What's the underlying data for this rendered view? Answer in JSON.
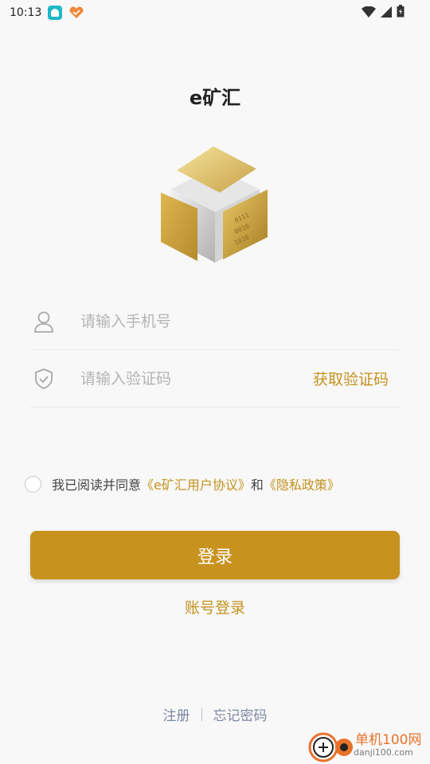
{
  "status_bar": {
    "time": "10:13"
  },
  "app": {
    "title": "e矿汇"
  },
  "form": {
    "phone_placeholder": "请输入手机号",
    "code_placeholder": "请输入验证码",
    "get_code_label": "获取验证码"
  },
  "agreement": {
    "prefix": "我已阅读并同意",
    "user_agreement": "《e矿汇用户协议》",
    "conjunction": "和",
    "privacy_policy": "《隐私政策》"
  },
  "login_button": "登录",
  "account_login": "账号登录",
  "footer": {
    "register": "注册",
    "forgot_password": "忘记密码"
  },
  "watermark": {
    "name": "单机100网",
    "url": "danji100.com"
  },
  "colors": {
    "accent": "#c8921f",
    "link": "#c4921e",
    "footer_link": "#7e88a4"
  },
  "icons": [
    "user-icon",
    "shield-check-icon",
    "wifi-icon",
    "signal-icon",
    "battery-icon"
  ]
}
